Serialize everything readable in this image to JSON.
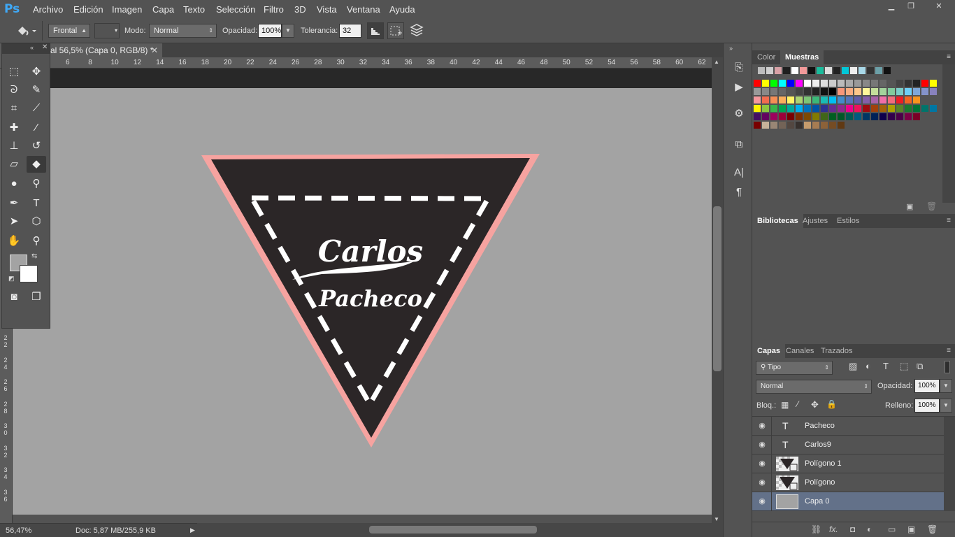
{
  "menubar": {
    "logo": "Ps",
    "items": [
      "Archivo",
      "Edición",
      "Imagen",
      "Capa",
      "Texto",
      "Selección",
      "Filtro",
      "3D",
      "Vista",
      "Ventana",
      "Ayuda"
    ],
    "win_min": "▁",
    "win_restore": "❐",
    "win_close": "✕"
  },
  "options": {
    "source_select": "Frontal",
    "mode_label": "Modo:",
    "mode_value": "Normal",
    "opacity_label": "Opacidad:",
    "opacity_value": "100%",
    "tolerance_label": "Tolerancia:",
    "tolerance_value": "32"
  },
  "document": {
    "tab_title": "al 56,5% (Capa 0, RGB/8) *",
    "close": "✕",
    "artwork_text_1": "Carlos",
    "artwork_text_2": "Pacheco",
    "colors": {
      "outer_border": "#f6a3a0",
      "fill": "#2b2627",
      "dashes": "#ffffff",
      "background": "#a3a3a3"
    }
  },
  "ruler_top": [
    "6",
    "8",
    "10",
    "12",
    "14",
    "16",
    "18",
    "20",
    "22",
    "24",
    "26",
    "28",
    "30",
    "32",
    "34",
    "36",
    "38",
    "40",
    "42",
    "44",
    "46",
    "48",
    "50",
    "52",
    "54",
    "56",
    "58",
    "60",
    "62"
  ],
  "ruler_left": [
    "2\n2",
    "2\n4",
    "2\n6",
    "2\n8",
    "3\n0",
    "3\n2",
    "3\n4",
    "3\n6"
  ],
  "status": {
    "zoom": "56,47%",
    "doc": "Doc: 5,87 MB/255,9 KB",
    "arrow": "▶"
  },
  "top_panel": {
    "tabs": [
      "Color",
      "Muestras"
    ],
    "active": "Muestras"
  },
  "lib_panel": {
    "tabs": [
      "Bibliotecas",
      "Ajustes",
      "Estilos"
    ],
    "active": "Bibliotecas"
  },
  "layers_panel": {
    "tabs": [
      "Capas",
      "Canales",
      "Trazados"
    ],
    "active": "Capas",
    "filter_value": "Tipo",
    "blend_value": "Normal",
    "opacity_label": "Opacidad:",
    "opacity_value": "100%",
    "lock_label": "Bloq.:",
    "fill_label": "Relleno:",
    "fill_value": "100%",
    "layers": [
      {
        "name": "Pacheco",
        "kind": "text",
        "glyph": "T"
      },
      {
        "name": "Carlos9",
        "kind": "text",
        "glyph": "T"
      },
      {
        "name": "Polígono 1",
        "kind": "shape",
        "glyph": ""
      },
      {
        "name": "Polígono",
        "kind": "shape",
        "glyph": ""
      },
      {
        "name": "Capa 0",
        "kind": "fill",
        "glyph": ""
      }
    ],
    "selected": "Capa 0",
    "footer_fx": "fx."
  }
}
